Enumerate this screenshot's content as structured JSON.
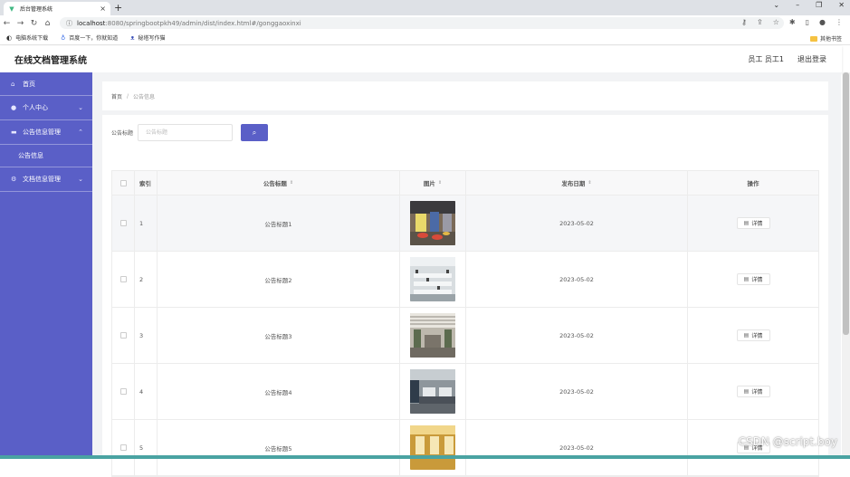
{
  "browser": {
    "tab_title": "后台管理系统",
    "url_host": "localhost",
    "url_rest": ":8080/springbootpkh49/admin/dist/index.html#/gonggaoxinxi",
    "bookmarks": [
      "电脑系统下载",
      "百度一下，你就知道",
      "秘塔写作猫"
    ],
    "bookmarks_right": "其他书签"
  },
  "header": {
    "title": "在线文档管理系统",
    "user": "员工 员工1",
    "logout": "退出登录"
  },
  "sidebar": {
    "items": [
      {
        "label": "首页"
      },
      {
        "label": "个人中心"
      },
      {
        "label": "公告信息管理"
      },
      {
        "label": "公告信息"
      },
      {
        "label": "文档信息管理"
      }
    ]
  },
  "breadcrumb": {
    "home": "首页",
    "separator": "/",
    "current": "公告信息"
  },
  "search": {
    "label": "公告标题",
    "placeholder": "公告标题"
  },
  "table": {
    "headers": {
      "index": "索引",
      "title": "公告标题",
      "image": "图片",
      "date": "发布日期",
      "action": "操作"
    },
    "detail_label": "详情",
    "rows": [
      {
        "index": "1",
        "title": "公告标题1",
        "date": "2023-05-02"
      },
      {
        "index": "2",
        "title": "公告标题2",
        "date": "2023-05-02"
      },
      {
        "index": "3",
        "title": "公告标题3",
        "date": "2023-05-02"
      },
      {
        "index": "4",
        "title": "公告标题4",
        "date": "2023-05-02"
      },
      {
        "index": "5",
        "title": "公告标题5",
        "date": "2023-05-02"
      }
    ]
  },
  "watermark": "CSDN @script.boy",
  "colors": {
    "accent": "#5a5fc7"
  }
}
